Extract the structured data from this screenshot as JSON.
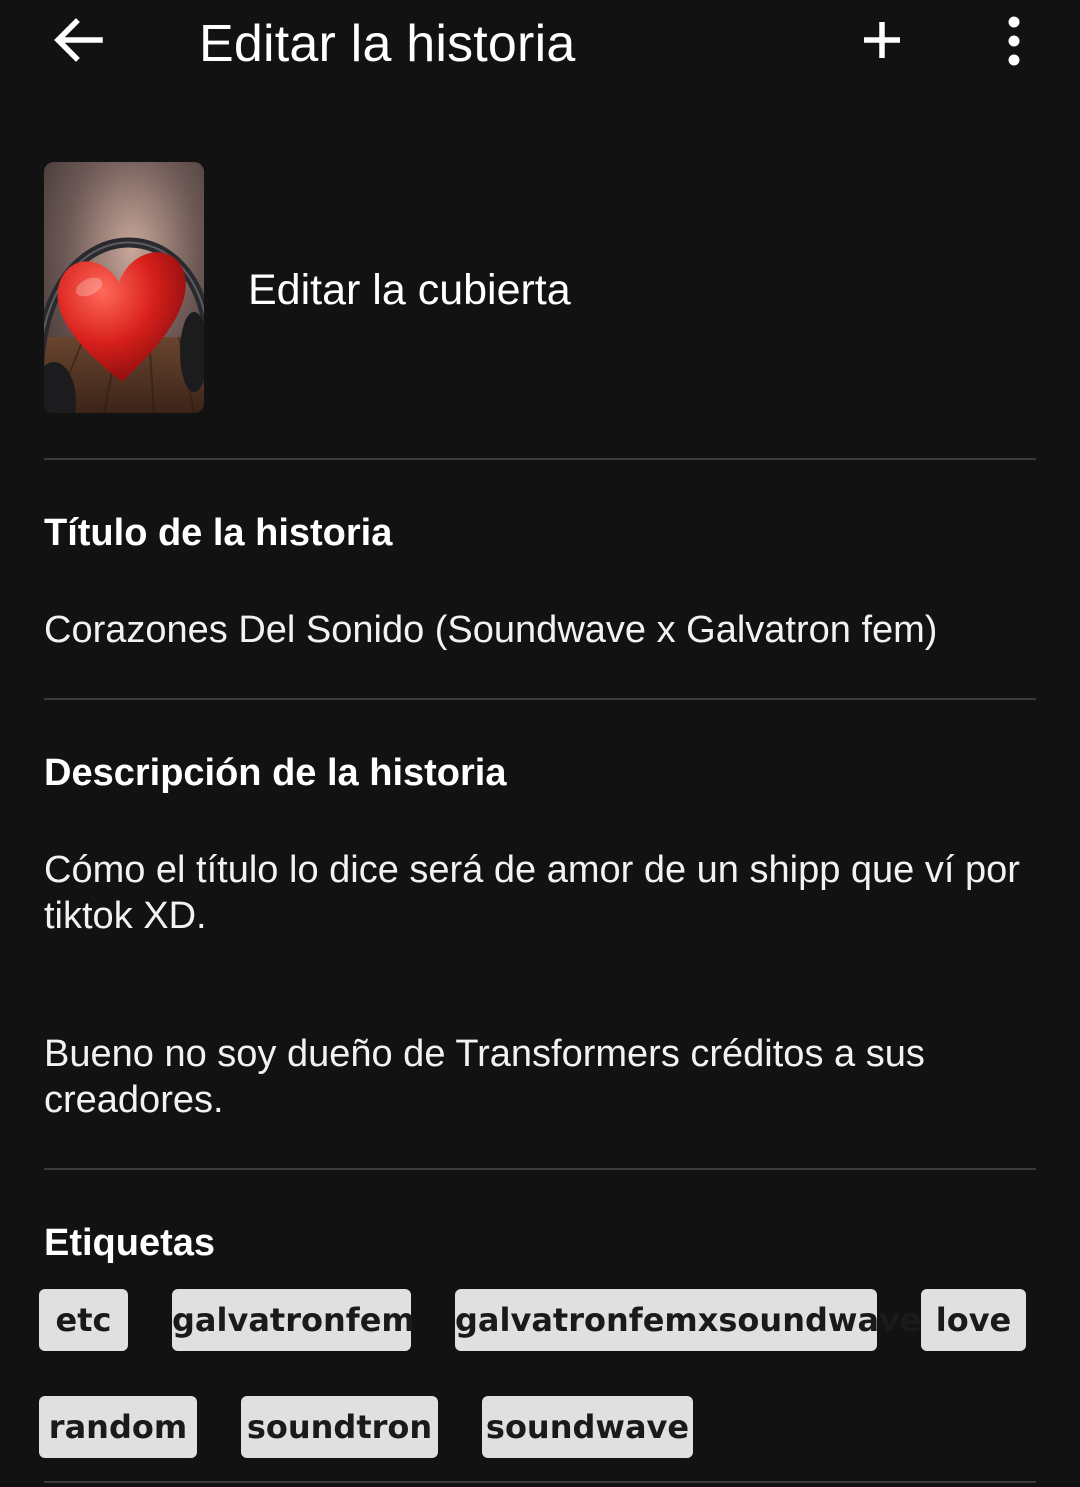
{
  "header": {
    "title": "Editar la historia",
    "back_icon": "arrow-left-icon",
    "add_icon": "plus-icon",
    "more_icon": "more-vertical-icon"
  },
  "cover": {
    "label": "Editar la cubierta",
    "image_description_icon": "heart-headphones-cover"
  },
  "title_section": {
    "label": "Título de la historia",
    "value": "Corazones Del Sonido (Soundwave x Galvatron fem)"
  },
  "description_section": {
    "label": "Descripción de la historia",
    "paragraph1": "Cómo el título lo dice será de amor de un shipp que ví por tiktok XD.",
    "paragraph2": "Bueno no soy dueño de Transformers créditos a sus creadores."
  },
  "tags_section": {
    "label": "Etiquetas",
    "tags": [
      "etc",
      "galvatronfem",
      "galvatronfemxsoundwave",
      "love",
      "random",
      "soundtron",
      "soundwave"
    ]
  },
  "colors": {
    "background": "#121212",
    "text": "#ffffff",
    "divider": "#3a3a3a",
    "tag_bg": "#e0e0e0",
    "tag_text": "#1a1a1a"
  }
}
